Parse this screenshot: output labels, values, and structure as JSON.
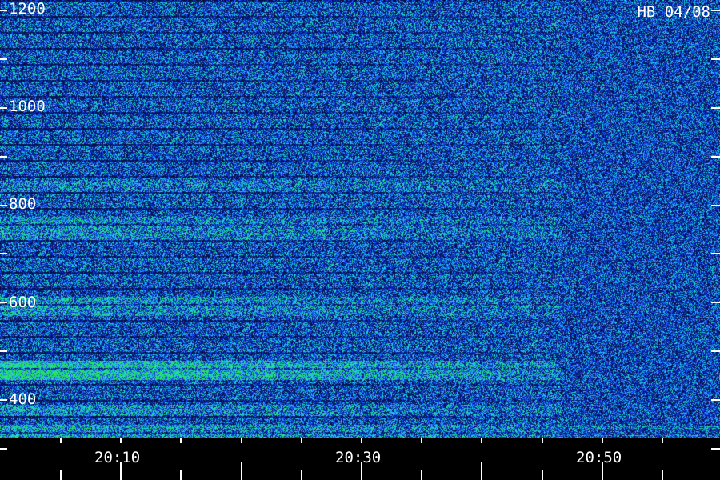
{
  "plot": {
    "title": "HB 04/08",
    "y_axis": {
      "label_values": [
        "1200",
        "1000",
        "800",
        "600",
        "400"
      ],
      "minor_values": [
        1200,
        1100,
        1000,
        900,
        800,
        700,
        600,
        500,
        400,
        300
      ],
      "min": 290,
      "max": 1200
    },
    "x_axis": {
      "labels": [
        "20:10",
        "20:30",
        "20:50"
      ]
    },
    "colors": {
      "background": "#0a1460",
      "low": "#1a2fd0",
      "mid": "#2f8ff0",
      "high": "#28e8c8",
      "peak": "#30f080",
      "axis": "#ffffff",
      "strip": "#000000"
    }
  }
}
